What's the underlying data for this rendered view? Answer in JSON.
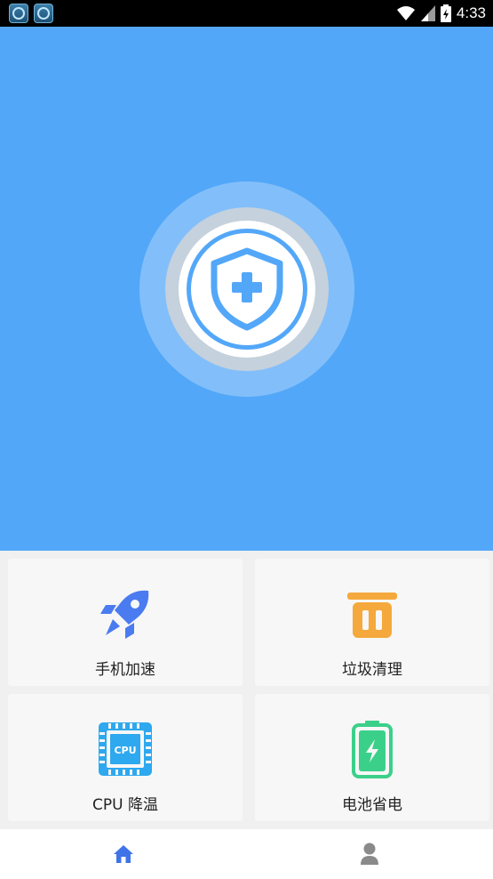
{
  "status_bar": {
    "time": "4:33",
    "notifications": [
      "app-notification-icon",
      "app-notification-icon"
    ]
  },
  "features": [
    {
      "label": "手机加速",
      "icon": "rocket-icon",
      "color": "#4a7bf0"
    },
    {
      "label": "垃圾清理",
      "icon": "trash-icon",
      "color": "#f5a93c"
    },
    {
      "label": "CPU 降温",
      "icon": "cpu-icon",
      "color": "#2ea8ee",
      "icon_text": "CPU"
    },
    {
      "label": "电池省电",
      "icon": "battery-icon",
      "color": "#3bd08a"
    }
  ],
  "bottom_nav": {
    "items": [
      {
        "icon": "home-icon",
        "active": true,
        "color": "#3f74e8"
      },
      {
        "icon": "user-icon",
        "active": false,
        "color": "#8a8a8a"
      }
    ]
  },
  "colors": {
    "hero_bg": "#53a7f8",
    "accent": "#53a7f8"
  }
}
